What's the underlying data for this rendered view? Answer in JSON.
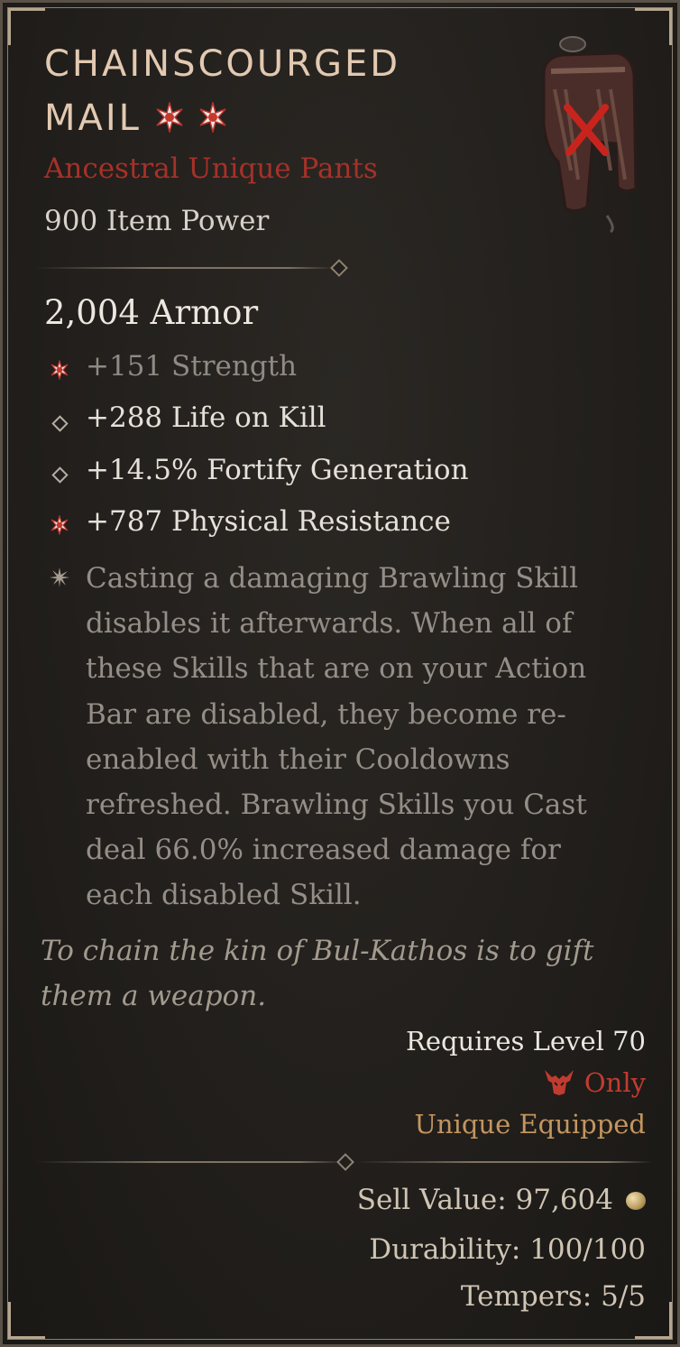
{
  "item": {
    "name_line1": "CHAINSCOURGED",
    "name_line2": "MAIL",
    "subtype": "Ancestral Unique Pants",
    "item_power": "900 Item Power",
    "armor": "2,004 Armor"
  },
  "stats": [
    {
      "text": "+151 Strength",
      "bullet": "greater-affix-icon"
    },
    {
      "text": "+288 Life on Kill",
      "bullet": "affix-diamond-icon"
    },
    {
      "text": "+14.5% Fortify Generation",
      "bullet": "affix-diamond-icon"
    },
    {
      "text": "+787 Physical Resistance",
      "bullet": "greater-affix-icon"
    }
  ],
  "unique_power": "Casting a damaging Brawling Skill disables it afterwards. When all of these Skills that are on your Action Bar are disabled, they become re-enabled with their Cooldowns refreshed. Brawling Skills you Cast deal 66.0% increased damage for each disabled Skill.",
  "flavor": "To chain the kin of Bul-Kathos is to gift them a weapon.",
  "requirements": {
    "level": "Requires Level 70",
    "class_only": "Only",
    "class_icon": "barbarian-icon",
    "unique_equipped": "Unique Equipped"
  },
  "footer": {
    "sell_value": "Sell Value: 97,604",
    "sell_icon": "gold-coin-icon",
    "durability": "Durability: 100/100",
    "tempers": "Tempers: 5/5"
  },
  "colors": {
    "title": "#e2c9b1",
    "unique_red": "#a63128",
    "class_red": "#c23b30",
    "unique_gold": "#c3955f"
  }
}
